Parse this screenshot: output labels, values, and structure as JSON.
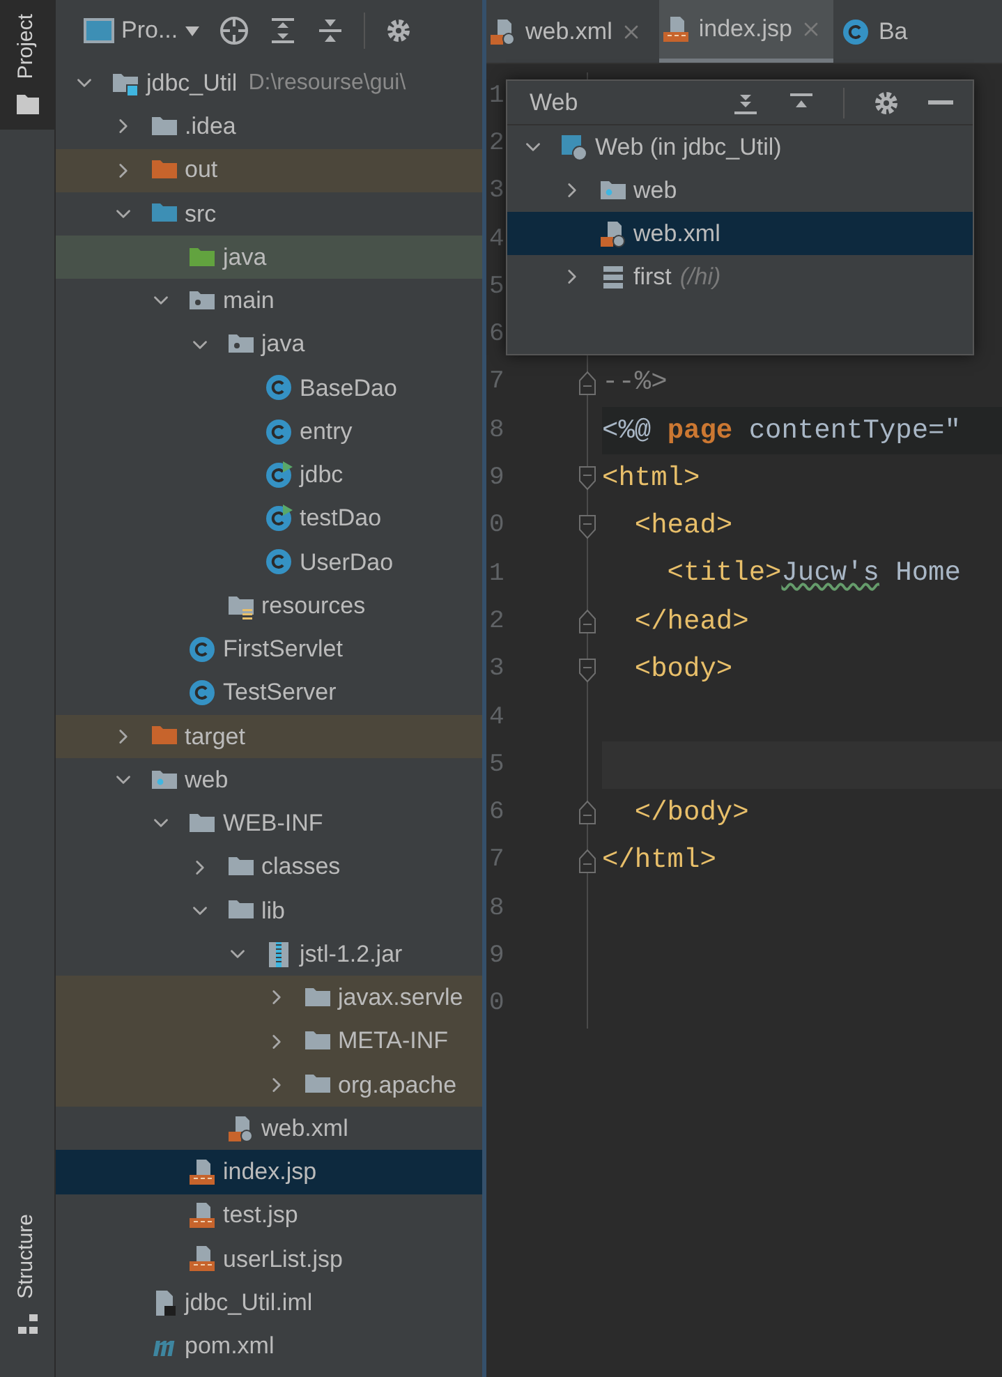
{
  "tool_strip": [
    {
      "label": "Project",
      "kind": "project",
      "selected": true
    },
    {
      "label": "Structure",
      "kind": "structure",
      "selected": false
    }
  ],
  "project_panel": {
    "view_selector": "Pro...",
    "tree": [
      {
        "label": "jdbc_Util",
        "path": "D:\\resourse\\gui\\",
        "kind": "module",
        "expanded": true,
        "selected": false,
        "children": [
          {
            "label": ".idea",
            "kind": "folder",
            "expanded": false,
            "selected": false
          },
          {
            "label": "out",
            "kind": "excluded-folder",
            "expanded": false,
            "selected": false
          },
          {
            "label": "src",
            "kind": "source-folder",
            "expanded": true,
            "selected": false,
            "children": [
              {
                "label": "java",
                "kind": "test-folder",
                "selected": false
              },
              {
                "label": "main",
                "kind": "package-folder",
                "expanded": true,
                "selected": false,
                "children": [
                  {
                    "label": "java",
                    "kind": "package-folder",
                    "expanded": true,
                    "selected": false,
                    "children": [
                      {
                        "label": "BaseDao",
                        "kind": "class",
                        "selected": false
                      },
                      {
                        "label": "entry",
                        "kind": "class",
                        "selected": false
                      },
                      {
                        "label": "jdbc",
                        "kind": "runnable-class",
                        "selected": false
                      },
                      {
                        "label": "testDao",
                        "kind": "runnable-class",
                        "selected": false
                      },
                      {
                        "label": "UserDao",
                        "kind": "class",
                        "selected": false
                      }
                    ]
                  },
                  {
                    "label": "resources",
                    "kind": "resources-folder",
                    "selected": false
                  }
                ]
              },
              {
                "label": "FirstServlet",
                "kind": "class",
                "selected": false
              },
              {
                "label": "TestServer",
                "kind": "class",
                "selected": false
              }
            ]
          },
          {
            "label": "target",
            "kind": "excluded-folder",
            "expanded": false,
            "selected": false
          },
          {
            "label": "web",
            "kind": "web-folder",
            "expanded": true,
            "selected": false,
            "children": [
              {
                "label": "WEB-INF",
                "kind": "folder",
                "expanded": true,
                "selected": false,
                "children": [
                  {
                    "label": "classes",
                    "kind": "folder",
                    "expanded": false,
                    "selected": false
                  },
                  {
                    "label": "lib",
                    "kind": "folder",
                    "expanded": true,
                    "selected": false,
                    "children": [
                      {
                        "label": "jstl-1.2.jar",
                        "kind": "jar",
                        "expanded": true,
                        "selected": false,
                        "children": [
                          {
                            "label": "javax.servle",
                            "kind": "library-folder",
                            "expanded": false,
                            "selected": false
                          },
                          {
                            "label": "META-INF",
                            "kind": "library-folder",
                            "expanded": false,
                            "selected": false
                          },
                          {
                            "label": "org.apache",
                            "kind": "library-folder",
                            "expanded": false,
                            "selected": false
                          }
                        ]
                      }
                    ]
                  },
                  {
                    "label": "web.xml",
                    "kind": "xml",
                    "selected": false
                  }
                ]
              },
              {
                "label": "index.jsp",
                "kind": "jsp",
                "selected": true
              },
              {
                "label": "test.jsp",
                "kind": "jsp",
                "selected": false
              },
              {
                "label": "userList.jsp",
                "kind": "jsp",
                "selected": false
              }
            ]
          },
          {
            "label": "jdbc_Util.iml",
            "kind": "iml",
            "selected": false
          },
          {
            "label": "pom.xml",
            "kind": "maven",
            "selected": false
          }
        ]
      }
    ]
  },
  "editor_tabs": [
    {
      "label": "web.xml",
      "kind": "xml",
      "selected": false,
      "closable": true
    },
    {
      "label": "index.jsp",
      "kind": "jsp",
      "selected": true,
      "closable": true
    },
    {
      "label": "Ba",
      "kind": "class",
      "selected": false,
      "closable": false
    }
  ],
  "web_popup": {
    "title": "Web",
    "tree": [
      {
        "label": "Web (in jdbc_Util)",
        "kind": "web-facet",
        "expanded": true,
        "selected": false,
        "children": [
          {
            "label": "web",
            "kind": "web-folder",
            "expanded": false,
            "selected": false
          },
          {
            "label": "web.xml",
            "kind": "xml",
            "selected": true
          },
          {
            "label": "first",
            "detail": "(/hi)",
            "kind": "servlet",
            "expanded": false,
            "selected": false
          }
        ]
      }
    ]
  },
  "editor_lines": [
    {
      "number": "1",
      "kind": "code"
    },
    {
      "number": "2",
      "kind": "code"
    },
    {
      "number": "3",
      "kind": "code"
    },
    {
      "number": "4",
      "kind": "code"
    },
    {
      "number": "5",
      "kind": "code"
    },
    {
      "number": "6",
      "kind": "code"
    },
    {
      "number": "7",
      "kind": "code",
      "fold_marker": {
        "kind": "end"
      },
      "segments": [
        {
          "kind": "comment",
          "text": "--%>"
        }
      ]
    },
    {
      "number": "8",
      "kind": "directive",
      "segments": [
        {
          "kind": "text",
          "text": "<%@ "
        },
        {
          "kind": "keyword",
          "text": "page"
        },
        {
          "kind": "text",
          "text": " contentType=\""
        }
      ]
    },
    {
      "number": "9",
      "kind": "code",
      "fold_marker": {
        "kind": "start"
      },
      "segments": [
        {
          "kind": "tag",
          "text": "<html>"
        }
      ]
    },
    {
      "number": "0",
      "kind": "code",
      "fold_marker": {
        "kind": "start"
      },
      "segments": [
        {
          "kind": "tag",
          "text": "  <head>"
        }
      ]
    },
    {
      "number": "1",
      "kind": "code",
      "segments": [
        {
          "kind": "tag",
          "text": "    <title>"
        },
        {
          "kind": "typo",
          "text": "Jucw's"
        },
        {
          "kind": "text",
          "text": " Home"
        }
      ]
    },
    {
      "number": "2",
      "kind": "code",
      "fold_marker": {
        "kind": "end"
      },
      "segments": [
        {
          "kind": "tag",
          "text": "  </head>"
        }
      ]
    },
    {
      "number": "3",
      "kind": "code",
      "fold_marker": {
        "kind": "start"
      },
      "segments": [
        {
          "kind": "tag",
          "text": "  <body>"
        }
      ]
    },
    {
      "number": "4",
      "kind": "code"
    },
    {
      "number": "5",
      "kind": "current"
    },
    {
      "number": "6",
      "kind": "code",
      "fold_marker": {
        "kind": "end"
      },
      "segments": [
        {
          "kind": "tag",
          "text": "  </body>"
        }
      ]
    },
    {
      "number": "7",
      "kind": "code",
      "fold_marker": {
        "kind": "end"
      },
      "segments": [
        {
          "kind": "tag",
          "text": "</html>"
        }
      ]
    },
    {
      "number": "8",
      "kind": "code"
    },
    {
      "number": "9",
      "kind": "code"
    },
    {
      "number": "0",
      "kind": "code"
    }
  ]
}
